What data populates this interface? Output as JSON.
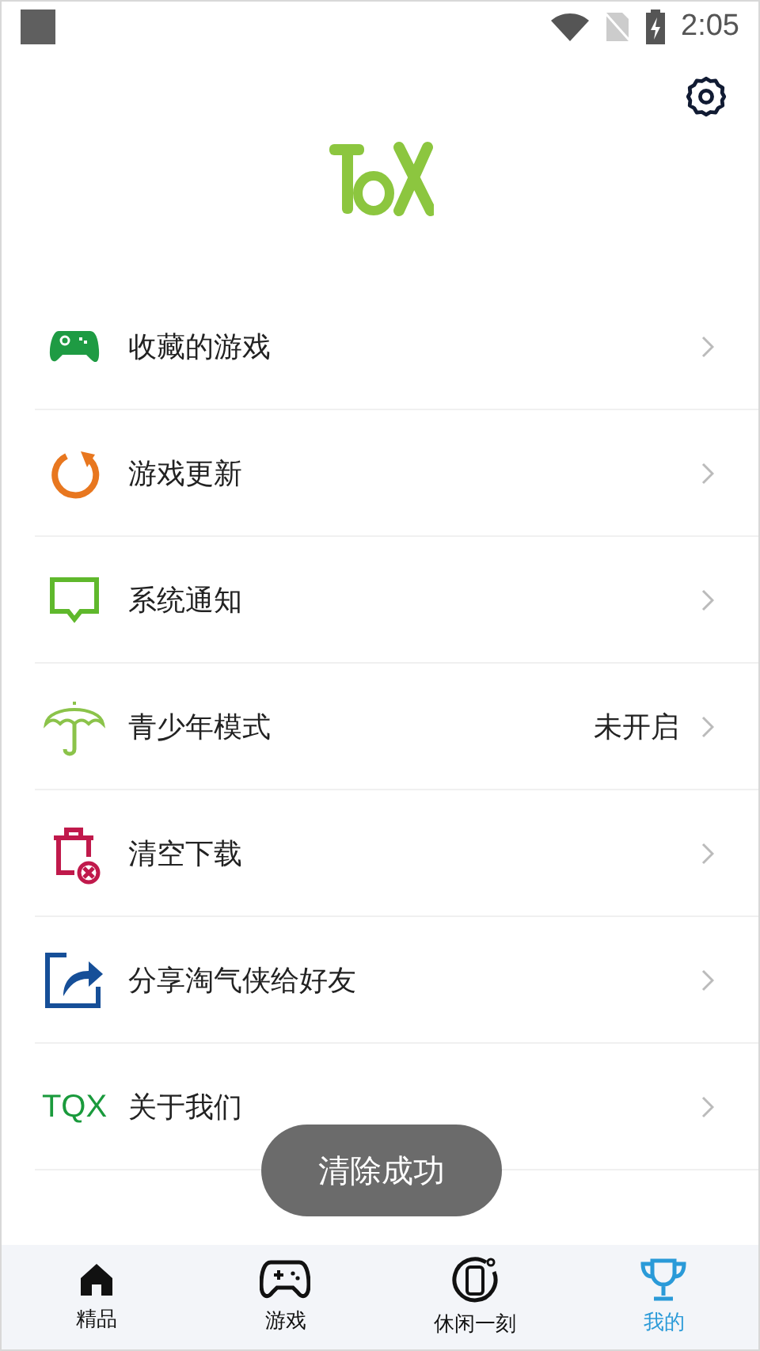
{
  "status_bar": {
    "time": "2:05"
  },
  "menu": [
    {
      "kind": "gamepad",
      "label": "收藏的游戏"
    },
    {
      "kind": "refresh",
      "label": "游戏更新"
    },
    {
      "kind": "message",
      "label": "系统通知"
    },
    {
      "kind": "umbrella",
      "label": "青少年模式",
      "value": "未开启"
    },
    {
      "kind": "trash",
      "label": "清空下载"
    },
    {
      "kind": "share",
      "label": "分享淘气侠给好友"
    },
    {
      "kind": "text",
      "icon_text": "TQX",
      "label": "关于我们"
    }
  ],
  "toast": "清除成功",
  "tabs": [
    {
      "kind": "home",
      "label": "精品",
      "selected": false
    },
    {
      "kind": "gamepad",
      "label": "游戏",
      "selected": false
    },
    {
      "kind": "phone",
      "label": "休闲一刻",
      "selected": false
    },
    {
      "kind": "trophy",
      "label": "我的",
      "selected": true
    }
  ]
}
